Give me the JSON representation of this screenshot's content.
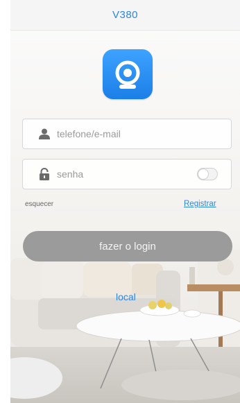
{
  "header": {
    "title": "V380"
  },
  "logo": {
    "icon": "camera-logo-icon",
    "color": "#2b8bf5"
  },
  "login_form": {
    "username_placeholder": "telefone/e-mail",
    "username_icon": "user-icon",
    "password_placeholder": "senha",
    "password_icon": "lock-icon",
    "show_password_toggle_on": false
  },
  "links": {
    "forgot": "esquecer",
    "register": "Registrar",
    "local": "local"
  },
  "login_button": {
    "label": "fazer o login"
  },
  "colors": {
    "accent": "#2b86e0",
    "button": "#949494",
    "header_bg": "#f5f5f5"
  }
}
